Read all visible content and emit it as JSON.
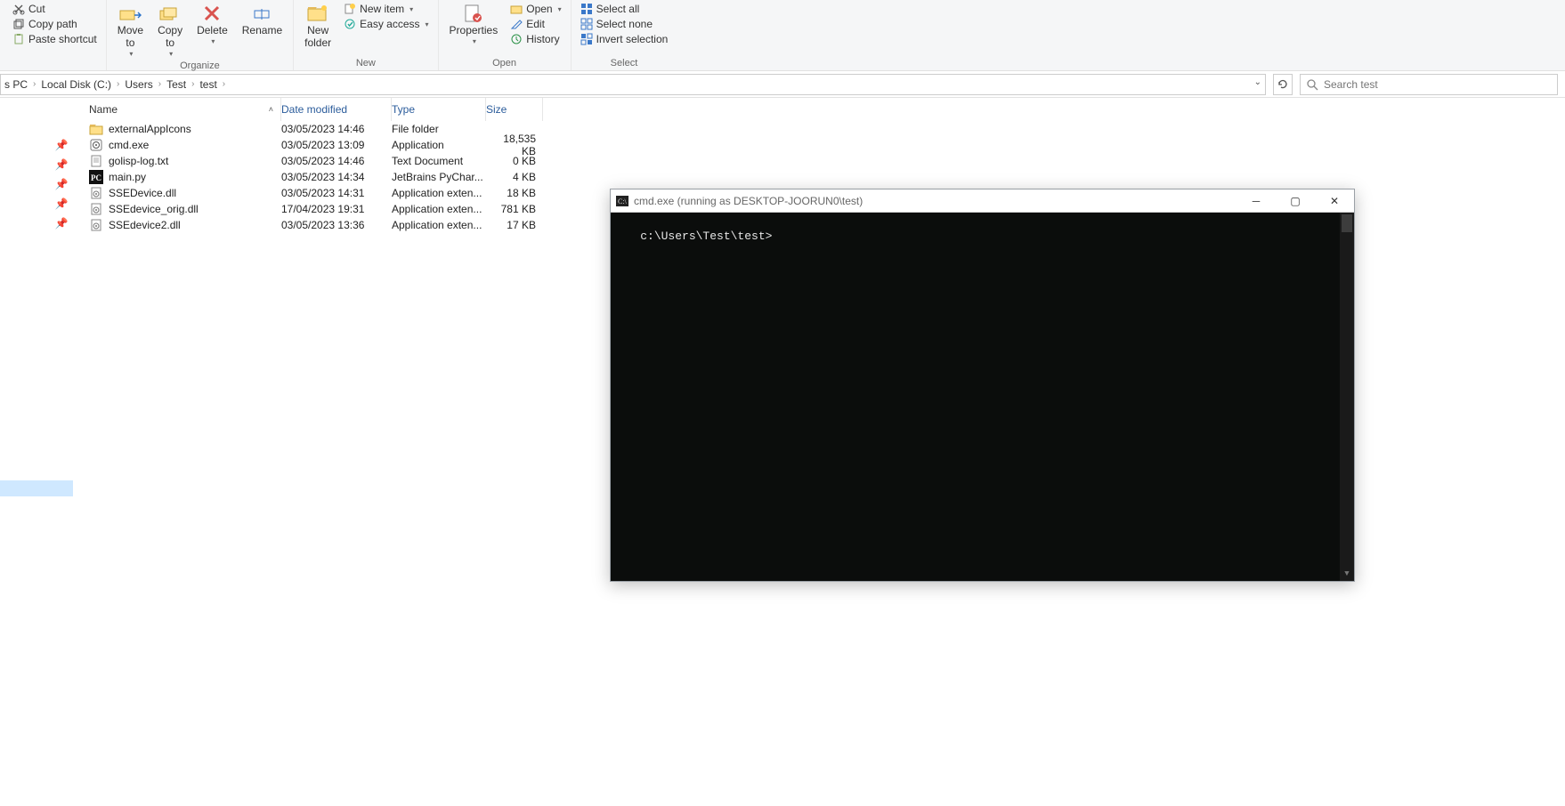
{
  "ribbon": {
    "clipboard": {
      "cut": "Cut",
      "copy_path": "Copy path",
      "paste_shortcut": "Paste shortcut"
    },
    "organize": {
      "label": "Organize",
      "move_to": "Move\nto",
      "copy_to": "Copy\nto",
      "delete": "Delete",
      "rename": "Rename"
    },
    "new": {
      "label": "New",
      "new_folder": "New\nfolder",
      "new_item": "New item",
      "easy_access": "Easy access"
    },
    "open": {
      "label": "Open",
      "properties": "Properties",
      "open": "Open",
      "edit": "Edit",
      "history": "History"
    },
    "select": {
      "label": "Select",
      "select_all": "Select all",
      "select_none": "Select none",
      "invert": "Invert selection"
    }
  },
  "breadcrumb": {
    "items": [
      "s PC",
      "Local Disk (C:)",
      "Users",
      "Test",
      "test"
    ]
  },
  "search": {
    "placeholder": "Search test"
  },
  "columns": {
    "name": "Name",
    "date": "Date modified",
    "type": "Type",
    "size": "Size"
  },
  "files": [
    {
      "icon": "folder",
      "name": "externalAppIcons",
      "date": "03/05/2023 14:46",
      "type": "File folder",
      "size": ""
    },
    {
      "icon": "exe",
      "name": "cmd.exe",
      "date": "03/05/2023 13:09",
      "type": "Application",
      "size": "18,535 KB"
    },
    {
      "icon": "txt",
      "name": "golisp-log.txt",
      "date": "03/05/2023 14:46",
      "type": "Text Document",
      "size": "0 KB"
    },
    {
      "icon": "pc",
      "name": "main.py",
      "date": "03/05/2023 14:34",
      "type": "JetBrains PyChar...",
      "size": "4 KB"
    },
    {
      "icon": "dll",
      "name": "SSEDevice.dll",
      "date": "03/05/2023 14:31",
      "type": "Application exten...",
      "size": "18 KB"
    },
    {
      "icon": "dll",
      "name": "SSEdevice_orig.dll",
      "date": "17/04/2023 19:31",
      "type": "Application exten...",
      "size": "781 KB"
    },
    {
      "icon": "dll",
      "name": "SSEdevice2.dll",
      "date": "03/05/2023 13:36",
      "type": "Application exten...",
      "size": "17 KB"
    }
  ],
  "cmd": {
    "title": "cmd.exe (running as DESKTOP-JOORUN0\\test)",
    "prompt": "c:\\Users\\Test\\test>"
  }
}
